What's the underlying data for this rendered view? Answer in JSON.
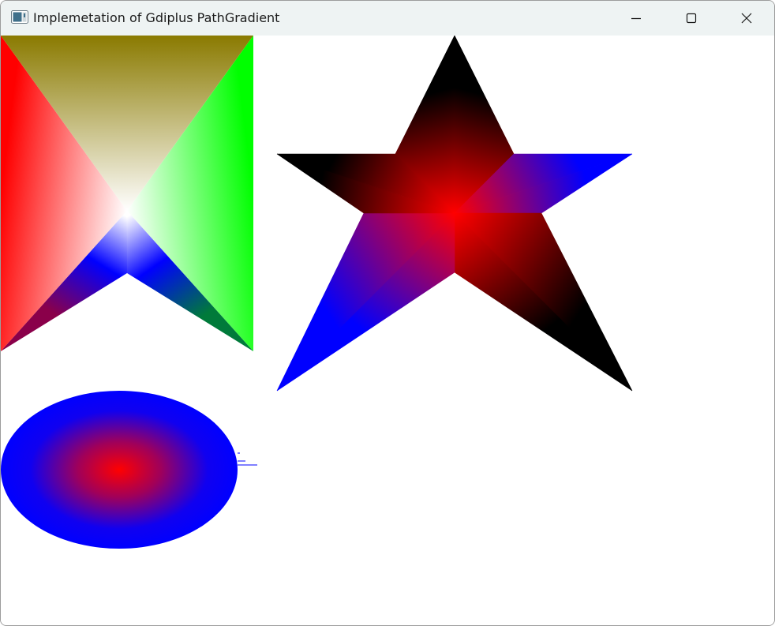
{
  "window": {
    "title": "Implemetation of Gdiplus PathGradient",
    "app_icon": "window-app-icon",
    "buttons": {
      "minimize_icon": "minimize-icon",
      "maximize_icon": "maximize-icon",
      "close_icon": "close-icon"
    }
  },
  "canvas": {
    "background": "#ffffff",
    "shapes": [
      {
        "name": "arrow-gradient-shape",
        "kind": "path-gradient",
        "center_color": "#ffffff",
        "surround_colors": [
          "#ff0000",
          "#00ff00",
          "#0000ff"
        ]
      },
      {
        "name": "star-gradient-shape",
        "kind": "path-gradient",
        "center_color": "#ff0000",
        "surround_colors": [
          "#000000",
          "#00ff00",
          "#0000ff",
          "#ffffff"
        ]
      },
      {
        "name": "ellipse-gradient-shape",
        "kind": "path-gradient",
        "center_color": "#ff0000",
        "surround_color": "#0000ff"
      }
    ]
  }
}
